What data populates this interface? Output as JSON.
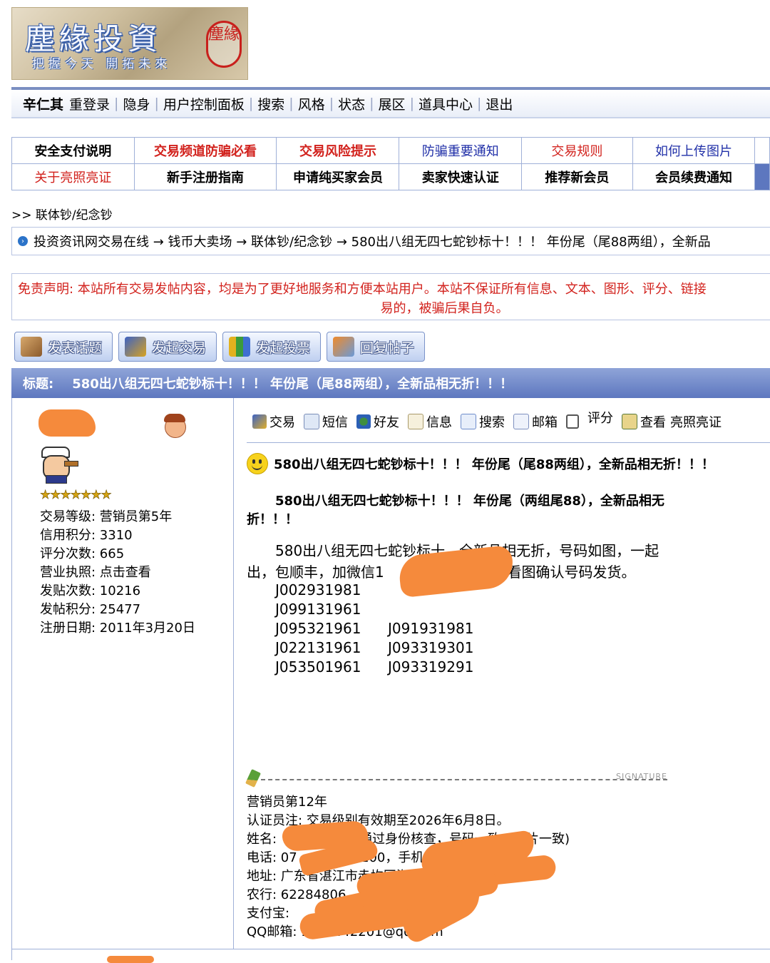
{
  "logo": {
    "title": "塵緣投資",
    "slogan": "把握今天 開拓未來",
    "seal": "塵緣"
  },
  "topnav": {
    "username": "辛仁其",
    "links": [
      "重登录",
      "隐身",
      "用户控制面板",
      "搜索",
      "风格",
      "状态",
      "展区",
      "道具中心",
      "退出"
    ]
  },
  "notices": {
    "row1": [
      "安全支付说明",
      "交易频道防骗必看",
      "交易风险提示",
      "防骗重要通知",
      "交易规则",
      "如何上传图片"
    ],
    "row2": [
      "关于亮照亮证",
      "新手注册指南",
      "申请纯买家会员",
      "卖家快速认证",
      "推荐新会员",
      "会员续费通知"
    ]
  },
  "breadcrumb_short": ">> 联体钞/纪念钞",
  "breadcrumb": "投资资讯网交易在线 → 钱币大卖场 → 联体钞/纪念钞 → 580出八组无四七蛇钞标十！！！ 年份尾（尾88两组），全新品",
  "disclaimer": {
    "line1": "免责声明:  本站所有交易发帖内容，均是为了更好地服务和方便本站用户。本站不保证所有信息、文本、图形、评分、链接",
    "line2": "易的，被骗后果自负。"
  },
  "actions": [
    "发表话题",
    "发起交易",
    "发起投票",
    "回复帖子"
  ],
  "thread": {
    "title_label": "标题:",
    "title": "580出八组无四七蛇钞标十！！！ 年份尾（尾88两组），全新品相无折！！！"
  },
  "user": {
    "stats": [
      "交易等级: 营销员第5年",
      "信用积分: 3310",
      "评分次数: 665",
      "营业执照: 点击查看",
      "发贴次数: 10216",
      "发帖积分: 25477",
      "注册日期: 2011年3月20日"
    ],
    "stars": "★★★★★★★"
  },
  "post_toolbar": [
    "交易",
    "短信",
    "好友",
    "信息",
    "搜索",
    "邮箱",
    "评分",
    "查看",
    "亮照亮证"
  ],
  "post": {
    "heading": "580出八组无四七蛇钞标十！！！ 年份尾（尾88两组），全新品相无折！！！",
    "subheading_1": "580出八组无四七蛇钞标十！！！ 年份尾（两组尾88），全新品相无",
    "subheading_2": "折！！！",
    "body_1": "580出八组无四七蛇钞标十，全新品相无折，号码如图，一起",
    "body_2a": "出，包顺丰，加微信1",
    "body_2b": "2看图确认号码发货。",
    "serials_col1": [
      "J002931981",
      "J099131961",
      "J095321961",
      "J022131961",
      "J053501961"
    ],
    "serials_col2": [
      "",
      "",
      "J091931981",
      "J093319301",
      "J093319291"
    ]
  },
  "signature": {
    "tag": "SIGNATURE",
    "lines": [
      "营销员第12年",
      "认证员注: 交易级别有效期至2026年6月8日。",
      "姓名:",
      "通过身份核查，号码一致，照片一致)",
      "电话: 07",
      "100，手机:",
      "地址: 广东省湛江市赤坎区海北",
      "农行: 62284806",
      "支付宝:",
      "QQ邮箱: 1448442201@qq.com"
    ]
  },
  "colors": {
    "accent": "#5d77bf",
    "notice_red": "#d2221d",
    "notice_blue": "#2130a8",
    "redaction": "#f58a3c"
  }
}
